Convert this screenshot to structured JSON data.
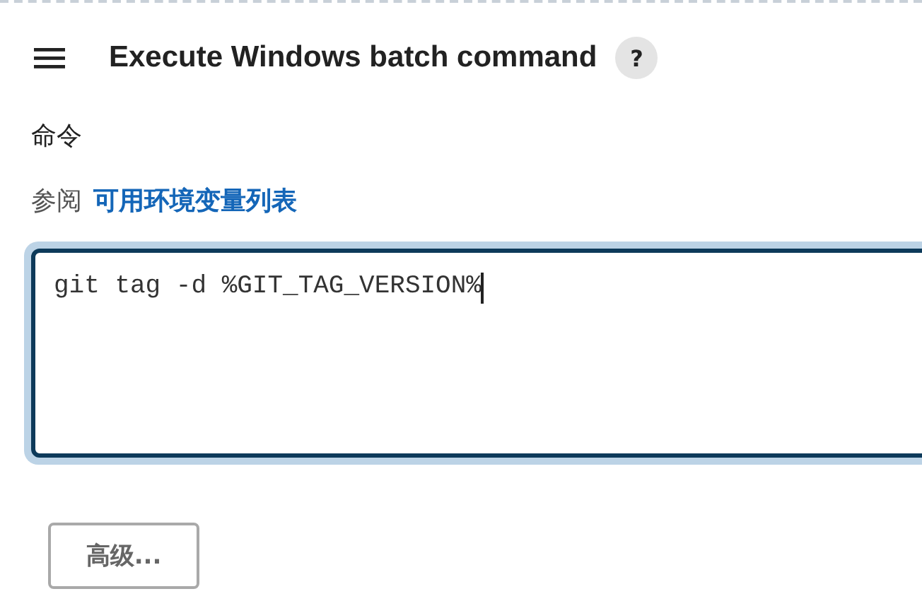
{
  "section": {
    "title": "Execute Windows batch command",
    "help": "?"
  },
  "command": {
    "label": "命令",
    "see_also": "参阅",
    "env_link": "可用环境变量列表",
    "value": "git tag -d %GIT_TAG_VERSION%",
    "focused": true
  },
  "buttons": [
    {
      "label": "高级..."
    }
  ]
}
